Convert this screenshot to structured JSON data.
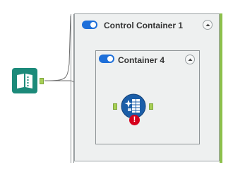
{
  "control_container": {
    "title": "Control Container 1",
    "enabled": true,
    "accent_color": "#8cc04b",
    "toggle_color": "#1e6fd9"
  },
  "inner_container": {
    "title": "Container 4",
    "enabled": true
  },
  "tools": {
    "input": {
      "icon": "book-input-icon",
      "color": "#1c8a7a"
    },
    "spatial": {
      "icon": "spatial-grid-icon",
      "error_icon": "error-badge-icon",
      "error_text": "!",
      "error_color": "#d6001c"
    }
  }
}
